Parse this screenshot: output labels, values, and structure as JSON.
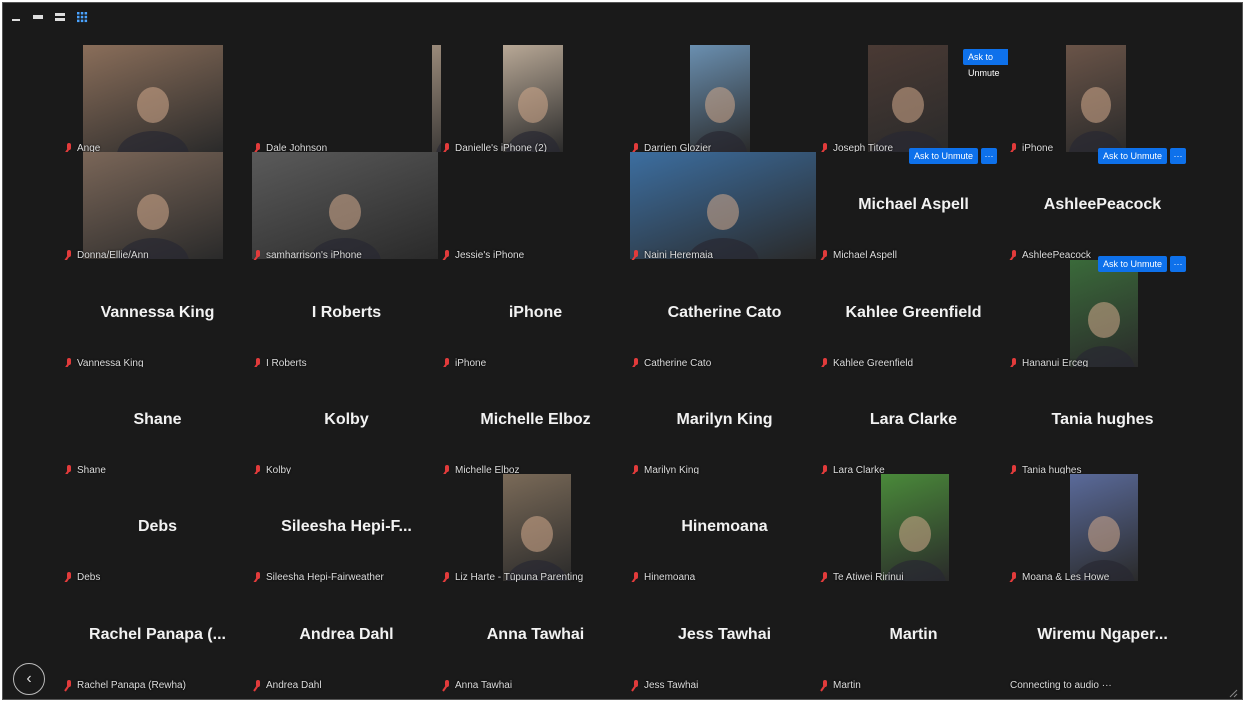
{
  "toolbar": {
    "icons": [
      "minimize-icon",
      "single-view-icon",
      "speaker-view-icon",
      "gallery-view-icon"
    ]
  },
  "colors": {
    "accent": "#0e71eb",
    "muted": "#e23b3b",
    "bg": "#1a1a1a"
  },
  "ask_to_unmute_label": "Ask to Unmute",
  "more_label": "···",
  "rows": [
    [
      {
        "label": "Ange",
        "video": true,
        "tone": "#8a6e5a"
      },
      {
        "label": "Dale Johnson",
        "video": true,
        "tone": "#9a8a7a"
      },
      {
        "label": "Danielle's iPhone (2)",
        "video": true,
        "tone": "#b8a896"
      },
      {
        "label": "Darrien Glozier",
        "video": true,
        "tone": "#6a8fb0"
      },
      {
        "label": "Joseph Titore",
        "video": true,
        "tone": "#4a3a34",
        "unmute": true
      },
      {
        "label": "iPhone",
        "video": true,
        "tone": "#6a5448"
      }
    ],
    [
      {
        "label": "Donna/Ellie/Ann",
        "video": true,
        "tone": "#7a6658"
      },
      {
        "label": "samharrison's iPhone",
        "video": true,
        "tone": "#5a5a5a"
      },
      {
        "label": "Jessie's iPhone",
        "video": false,
        "name": ""
      },
      {
        "label": "Naini Heremaia",
        "video": true,
        "tone": "#3c6ea0"
      },
      {
        "label": "Michael Aspell",
        "video": false,
        "name": "Michael Aspell",
        "unmute": true
      },
      {
        "label": "AshleePeacock",
        "video": false,
        "name": "AshleePeacock",
        "unmute": true
      }
    ],
    [
      {
        "label": "Vannessa King",
        "video": false,
        "name": "Vannessa King"
      },
      {
        "label": "I Roberts",
        "video": false,
        "name": "I Roberts"
      },
      {
        "label": "iPhone",
        "video": false,
        "name": "iPhone"
      },
      {
        "label": "Catherine Cato",
        "video": false,
        "name": "Catherine Cato"
      },
      {
        "label": "Kahlee Greenfield",
        "video": false,
        "name": "Kahlee Greenfield"
      },
      {
        "label": "Hananui Erceg",
        "video": true,
        "tone": "#3a6a3a",
        "unmute": true
      }
    ],
    [
      {
        "label": "Shane",
        "video": false,
        "name": "Shane"
      },
      {
        "label": "Kolby",
        "video": false,
        "name": "Kolby"
      },
      {
        "label": "Michelle Elboz",
        "video": false,
        "name": "Michelle Elboz"
      },
      {
        "label": "Marilyn King",
        "video": false,
        "name": "Marilyn King"
      },
      {
        "label": "Lara Clarke",
        "video": false,
        "name": "Lara Clarke"
      },
      {
        "label": "Tania hughes",
        "video": false,
        "name": "Tania hughes"
      }
    ],
    [
      {
        "label": "Debs",
        "video": false,
        "name": "Debs"
      },
      {
        "label": "Sileesha Hepi-Fairweather",
        "video": false,
        "name": "Sileesha  Hepi-F..."
      },
      {
        "label": "Liz Harte - Tūpuna Parenting",
        "video": true,
        "tone": "#7a6a58"
      },
      {
        "label": "Hinemoana",
        "video": false,
        "name": "Hinemoana"
      },
      {
        "label": "Te Atiwei Ririnui",
        "video": true,
        "tone": "#4a8a3a"
      },
      {
        "label": "Moana & Les Howe",
        "video": true,
        "tone": "#5a6a9a"
      }
    ],
    [
      {
        "label": "Rachel Panapa (Rewha)",
        "video": false,
        "name": "Rachel Panapa (..."
      },
      {
        "label": "Andrea Dahl",
        "video": false,
        "name": "Andrea Dahl"
      },
      {
        "label": "Anna Tawhai",
        "video": false,
        "name": "Anna Tawhai"
      },
      {
        "label": "Jess Tawhai",
        "video": false,
        "name": "Jess Tawhai"
      },
      {
        "label": "Martin",
        "video": false,
        "name": "Martin"
      },
      {
        "label": "Connecting to audio ···",
        "video": false,
        "name": "Wiremu  Ngaper...",
        "nomic": true
      }
    ]
  ]
}
